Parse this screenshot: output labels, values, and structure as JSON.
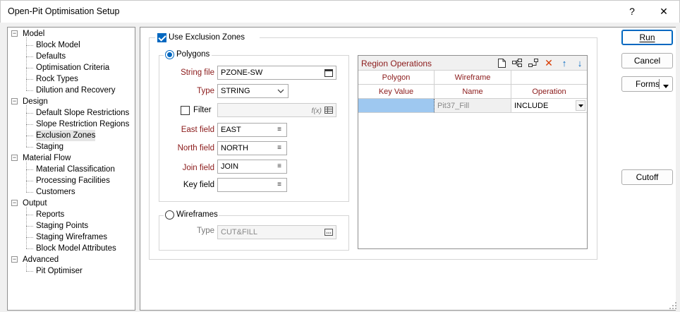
{
  "window": {
    "title": "Open-Pit Optimisation Setup",
    "help_label": "?",
    "close_label": "✕"
  },
  "tree": {
    "groups": [
      {
        "label": "Model",
        "items": [
          "Block Model",
          "Defaults",
          "Optimisation Criteria",
          "Rock Types",
          "Dilution and Recovery"
        ]
      },
      {
        "label": "Design",
        "items": [
          "Default Slope Restrictions",
          "Slope Restriction Regions",
          "Exclusion Zones",
          "Staging"
        ]
      },
      {
        "label": "Material Flow",
        "items": [
          "Material Classification",
          "Processing Facilities",
          "Customers"
        ]
      },
      {
        "label": "Output",
        "items": [
          "Reports",
          "Staging Points",
          "Staging Wireframes",
          "Block Model Attributes"
        ]
      },
      {
        "label": "Advanced",
        "items": [
          "Pit Optimiser"
        ]
      }
    ],
    "selected": "Exclusion Zones",
    "expander_symbol": "−"
  },
  "exclusion": {
    "use_label": "Use Exclusion Zones",
    "use_checked": true
  },
  "polygons": {
    "label": "Polygons",
    "selected": true,
    "string_file": {
      "label": "String file",
      "value": "PZONE-SW"
    },
    "type": {
      "label": "Type",
      "value": "STRING"
    },
    "filter": {
      "label": "Filter",
      "value": "",
      "checked": false,
      "fx_label": "f(x)"
    },
    "east": {
      "label": "East field",
      "value": "EAST"
    },
    "north": {
      "label": "North field",
      "value": "NORTH"
    },
    "join": {
      "label": "Join field",
      "value": "JOIN"
    },
    "key": {
      "label": "Key field",
      "value": ""
    }
  },
  "wireframes": {
    "label": "Wireframes",
    "selected": false,
    "type_label": "Type",
    "type_value": "CUT&FILL"
  },
  "region_ops": {
    "title": "Region Operations",
    "headers_top": [
      "Polygon",
      "Wireframe",
      ""
    ],
    "headers": [
      "Key Value",
      "Name",
      "Operation"
    ],
    "rows": [
      {
        "key_value": "",
        "name": "Pit37_Fill",
        "operation": "INCLUDE"
      }
    ]
  },
  "buttons": {
    "run": "Run",
    "cancel": "Cancel",
    "forms": "Forms",
    "cutoff": "Cutoff"
  },
  "colors": {
    "accent": "#0067c0",
    "required_label": "#8b1a1a",
    "selected_cell": "#9ec8f0"
  }
}
